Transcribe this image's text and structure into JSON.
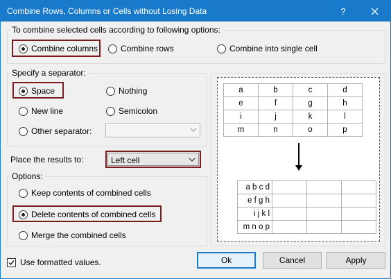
{
  "window": {
    "title": "Combine Rows, Columns or Cells without Losing Data",
    "help": "?",
    "close": "✕"
  },
  "combine": {
    "legend": "To combine selected cells according to following options:",
    "options": [
      "Combine columns",
      "Combine rows",
      "Combine into single cell"
    ],
    "selected": "Combine columns"
  },
  "separator": {
    "legend": "Specify a separator:",
    "space": "Space",
    "nothing": "Nothing",
    "newline": "New line",
    "semicolon": "Semicolon",
    "other": "Other separator:",
    "other_value": "",
    "selected": "Space"
  },
  "place": {
    "label": "Place the results to:",
    "value": "Left cell"
  },
  "options": {
    "legend": "Options:",
    "keep": "Keep contents of combined cells",
    "delete": "Delete contents of combined cells",
    "merge": "Merge the combined cells",
    "selected": "Delete contents of combined cells"
  },
  "preview": {
    "before": [
      [
        "a",
        "b",
        "c",
        "d"
      ],
      [
        "e",
        "f",
        "g",
        "h"
      ],
      [
        "i",
        "j",
        "k",
        "l"
      ],
      [
        "m",
        "n",
        "o",
        "p"
      ]
    ],
    "after": [
      [
        "a b c d",
        "",
        "",
        ""
      ],
      [
        "e f g h",
        "",
        "",
        ""
      ],
      [
        "i j k l",
        "",
        "",
        ""
      ],
      [
        "m n o p",
        "",
        "",
        ""
      ]
    ]
  },
  "footer": {
    "formatted_label": "Use formatted values.",
    "formatted_checked": true,
    "ok": "Ok",
    "cancel": "Cancel",
    "apply": "Apply"
  },
  "colors": {
    "titlebar": "#1979ca",
    "highlight": "#7b1c1c"
  }
}
